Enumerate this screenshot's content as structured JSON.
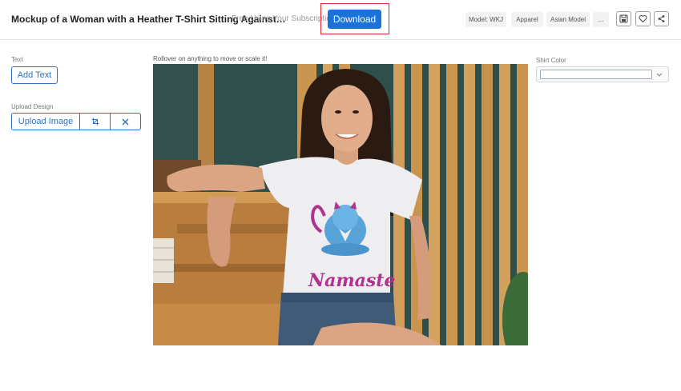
{
  "header": {
    "title": "Mockup of a Woman with a Heather T-Shirt Sitting Against…",
    "subtitle": "Free Using Your Subscription!",
    "download_label": "Download",
    "tags": [
      "Model: WKJ",
      "Apparel",
      "Asian Model",
      "..."
    ],
    "icons": [
      "save-icon",
      "heart-icon",
      "share-icon"
    ]
  },
  "sidebar": {
    "text_section_label": "Text",
    "add_text_label": "Add Text",
    "upload_section_label": "Upload Design",
    "upload_image_label": "Upload Image",
    "crop_icon": "crop-icon",
    "remove_icon": "close-icon"
  },
  "canvas": {
    "hint": "Rollover on anything to move or scale it!",
    "shirt_print_text": "Namaste"
  },
  "options": {
    "shirt_color_label": "Shirt Color",
    "shirt_color_value": ""
  },
  "colors": {
    "accent": "#1a73d9",
    "highlight": "#e0262e",
    "outline": "#2c73c9"
  }
}
